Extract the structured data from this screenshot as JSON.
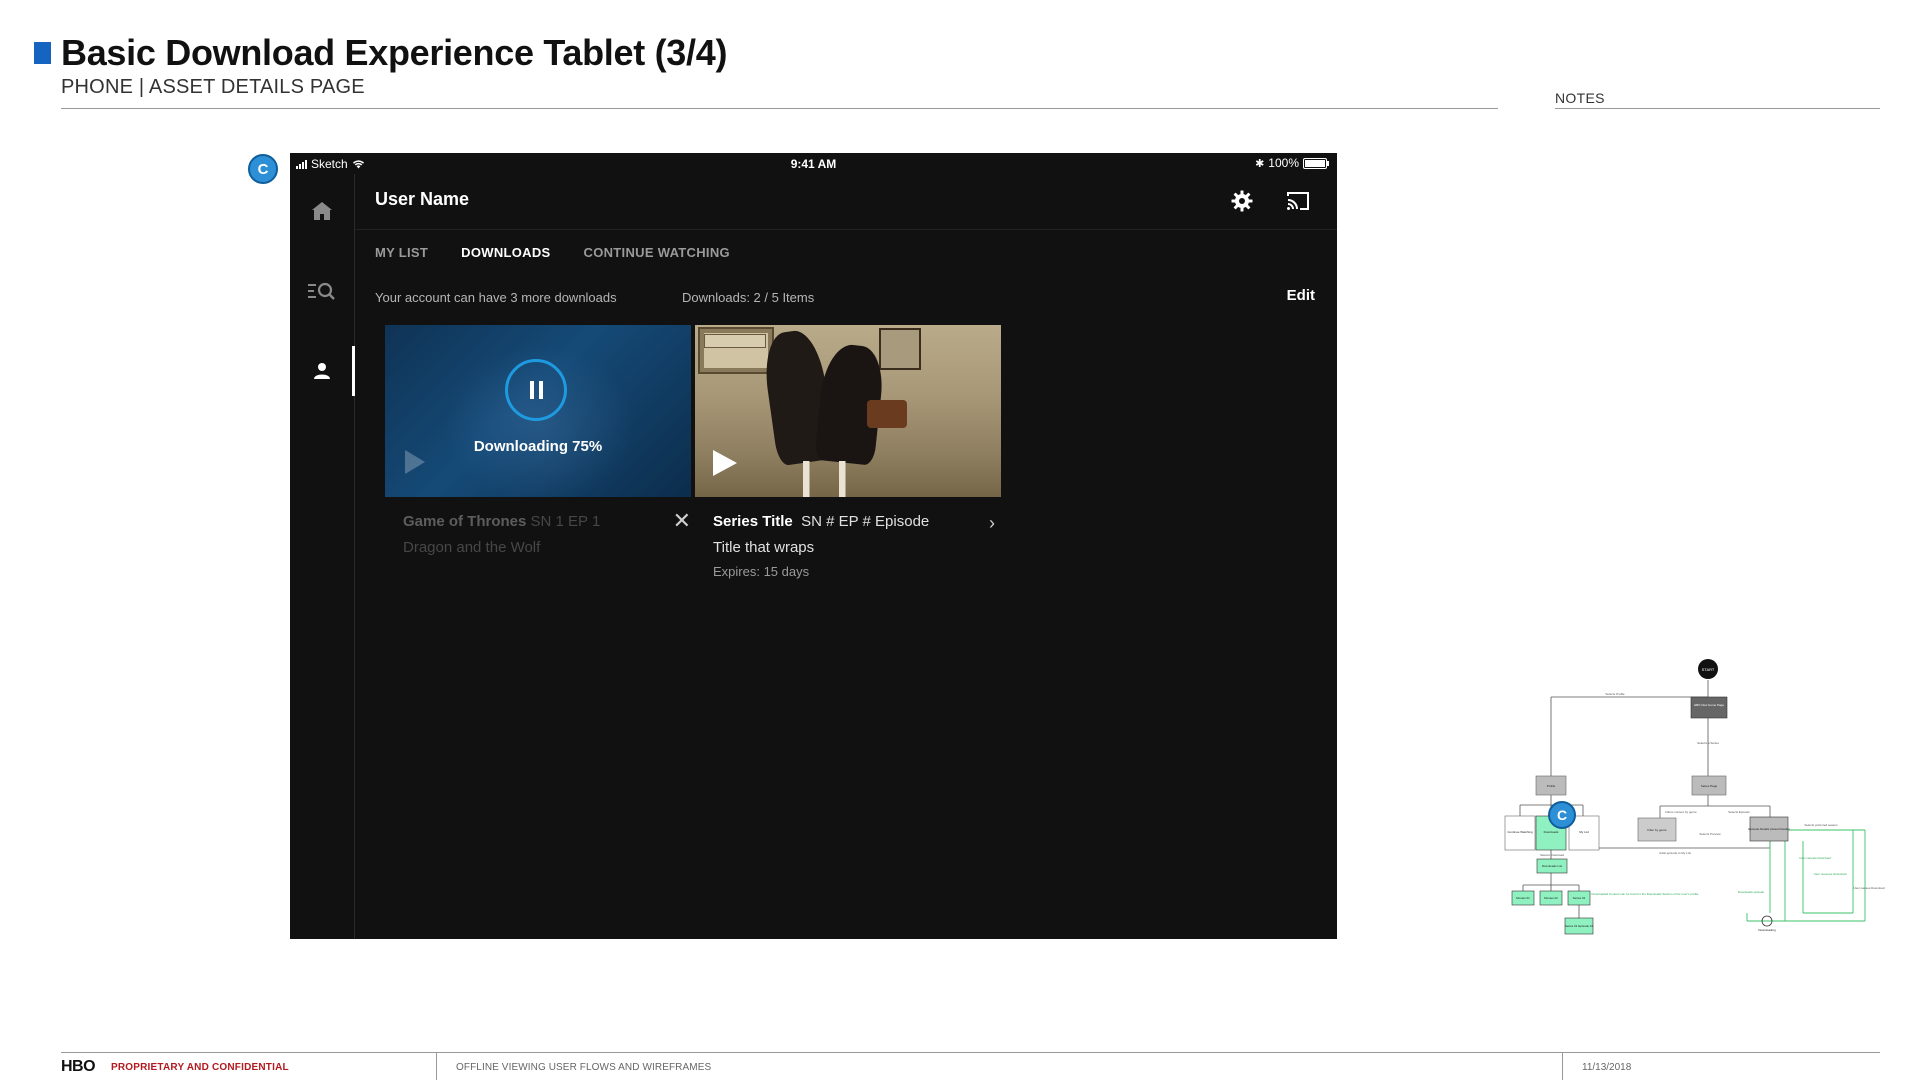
{
  "header": {
    "title": "Basic Download Experience Tablet (3/4)",
    "subtitle": "PHONE | ASSET DETAILS PAGE",
    "notes_label": "NOTES",
    "accent_color": "#1565c0"
  },
  "callout": {
    "label": "C",
    "color": "#2d8fd6"
  },
  "tablet": {
    "status_bar": {
      "carrier": "Sketch",
      "time": "9:41 AM",
      "battery": "100%"
    },
    "user_name": "User Name",
    "tabs": [
      {
        "label": "MY LIST",
        "active": false
      },
      {
        "label": "DOWNLOADS",
        "active": true
      },
      {
        "label": "CONTINUE WATCHING",
        "active": false
      }
    ],
    "account_info": "Your account can have  3  more downloads",
    "downloads_count": "Downloads: 2 / 5 Items",
    "edit_label": "Edit",
    "cards": [
      {
        "status": "Downloading 75%",
        "progress": 0.75,
        "title": "Game of Thrones",
        "episode": "SN 1 EP 1 Dragon and the Wolf",
        "action_icon": "close-icon"
      },
      {
        "title": "Series Title",
        "episode": "SN # EP # Episode Title that wraps",
        "expires": "Expires: 15 days",
        "action_icon": "chevron-right-icon"
      }
    ],
    "nav_icons": [
      "home-icon",
      "search-icon",
      "profile-icon"
    ],
    "active_nav": "profile-icon"
  },
  "flow_diagram": {
    "start": "START",
    "nodes": {
      "home": "HBO Now Home Page",
      "profile": "Profile",
      "series": "Series Page",
      "continue": "Continue Watching",
      "downloads": "Downloads",
      "mylist": "My List",
      "filter": "Filter by genre",
      "episode": "Episode Details (Asset Details)",
      "dl_list": "Downloads List",
      "movie1": "Movies 01",
      "movie2": "Movies 02",
      "series01": "Series 01",
      "series_ep": "Series 01 Episode 01",
      "downloading": "Downloading"
    },
    "edges": {
      "selects_profile": "Selects Profile",
      "selects_series": "Selects a Series",
      "filters_content": "Filters content by genre",
      "selects_episode": "Selects Episode",
      "selects_preview": "Selects Preview",
      "selects_download": "Selects Download",
      "adds_mylist": "Adds episode to My List",
      "selects_preferred": "Selects preferred season",
      "downloaded_note": "Downloaded Content can be found in the Downloads Section of the user's profile",
      "downloads_episode": "Downloads episode",
      "user_cancels": "User cancels Download",
      "user_resumes": "User resumes Download",
      "user_pauses": "User pauses Download"
    },
    "badge": "C"
  },
  "footer": {
    "brand": "HBO",
    "confidential": "PROPRIETARY AND CONFIDENTIAL",
    "doc_title": "OFFLINE VIEWING USER FLOWS AND WIREFRAMES",
    "date": "11/13/2018",
    "confidential_color": "#b3191f"
  }
}
